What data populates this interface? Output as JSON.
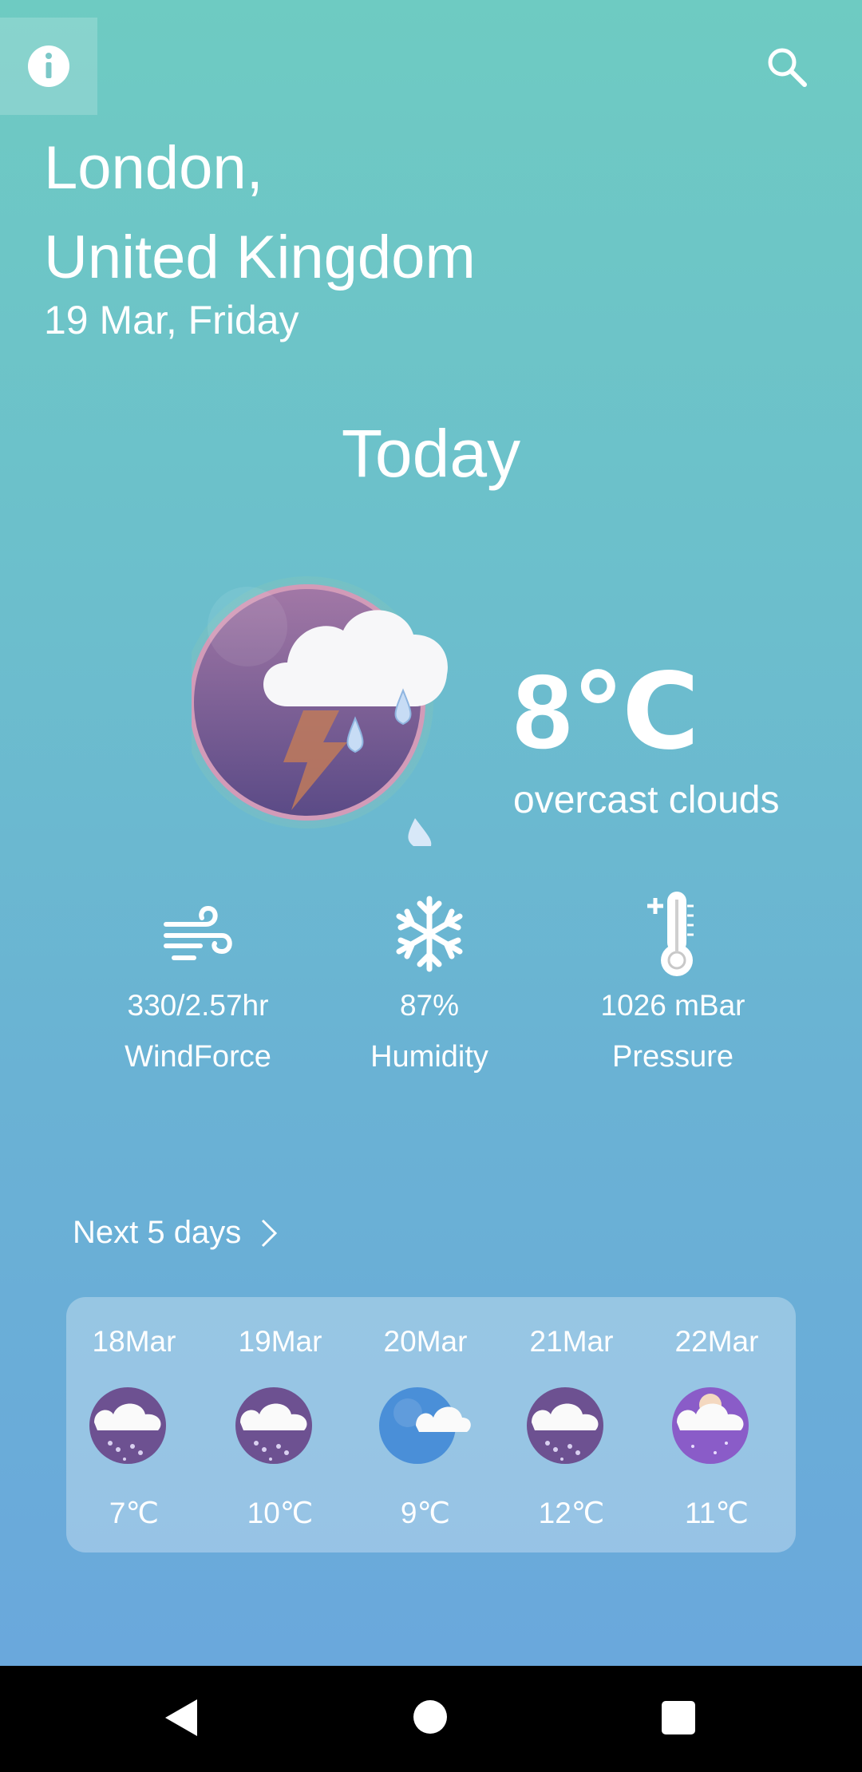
{
  "location": {
    "line1": "London,",
    "line2": "United Kingdom"
  },
  "date": "19 Mar, Friday",
  "today_label": "Today",
  "current": {
    "temperature": "8℃",
    "condition": "overcast clouds",
    "icon": "thunder-rain-cloud-icon"
  },
  "stats": [
    {
      "value": "330/2.57hr",
      "label": "WindForce",
      "icon": "wind-icon"
    },
    {
      "value": "87%",
      "label": "Humidity",
      "icon": "snowflake-icon"
    },
    {
      "value": "1026 mBar",
      "label": "Pressure",
      "icon": "thermometer-icon"
    }
  ],
  "next_days_label": "Next 5 days",
  "forecast": [
    {
      "date": "18Mar",
      "temp": "7℃",
      "icon": "rain-cloud-icon"
    },
    {
      "date": "19Mar",
      "temp": "10℃",
      "icon": "rain-cloud-icon"
    },
    {
      "date": "20Mar",
      "temp": "9℃",
      "icon": "cloud-icon"
    },
    {
      "date": "21Mar",
      "temp": "12℃",
      "icon": "rain-cloud-icon"
    },
    {
      "date": "22Mar",
      "temp": "11℃",
      "icon": "partly-cloudy-night-icon"
    }
  ],
  "colors": {
    "bg_top": "#6ecbc2",
    "bg_bottom": "#6aa8dc",
    "icon_purple": "#6a4b8c"
  }
}
